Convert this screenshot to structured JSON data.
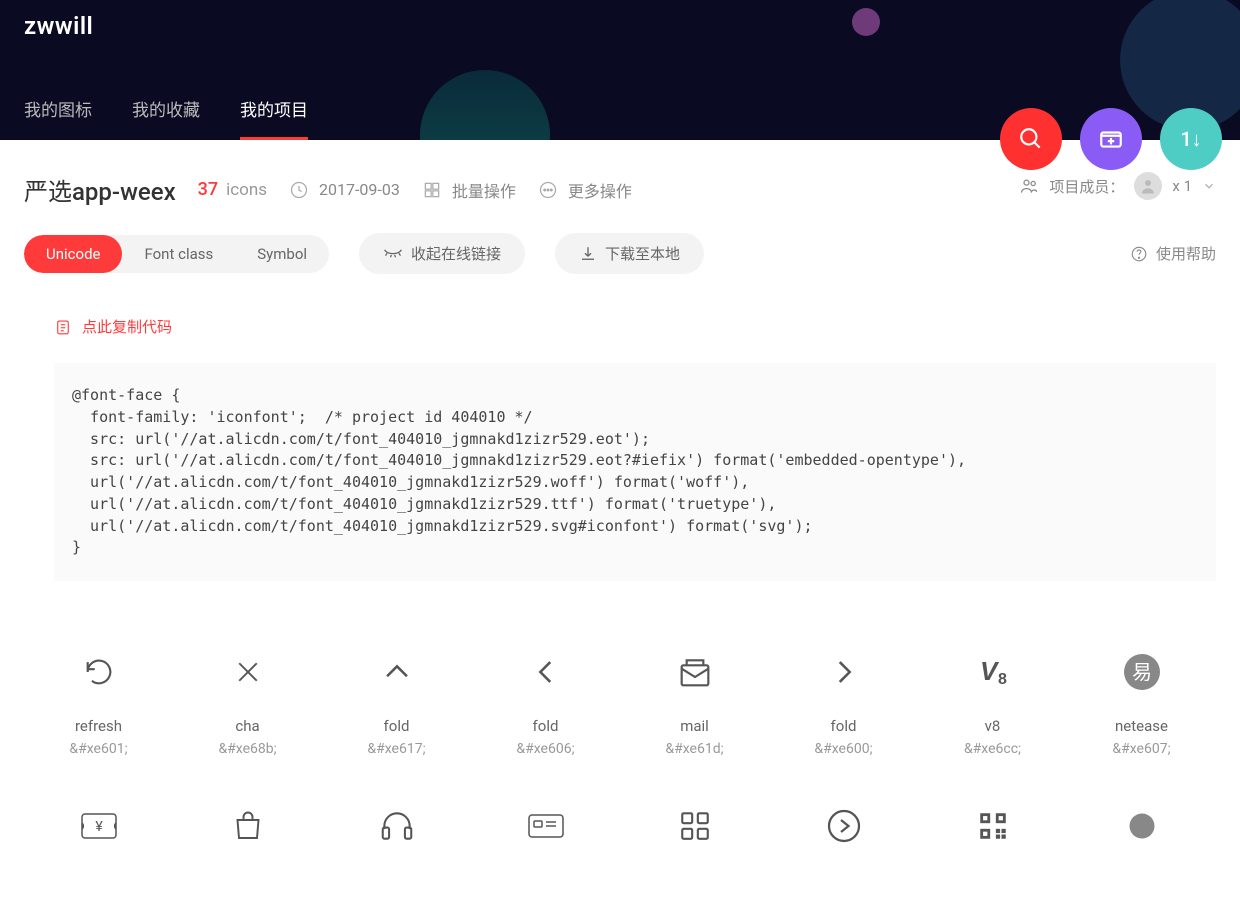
{
  "logo": "zwwill",
  "nav": {
    "tabs": [
      {
        "label": "我的图标",
        "active": false
      },
      {
        "label": "我的收藏",
        "active": false
      },
      {
        "label": "我的项目",
        "active": true
      }
    ]
  },
  "fabs": {
    "search": "search-icon",
    "add": "add-folder-icon",
    "sort": "sort-icon",
    "sort_text": "1↓"
  },
  "project": {
    "title": "严选app-weex",
    "count": "37",
    "count_label": "icons",
    "date": "2017-09-03",
    "batch": "批量操作",
    "more": "更多操作",
    "members_label": "项目成员：",
    "members_count": "x 1"
  },
  "seg": {
    "unicode": "Unicode",
    "fontclass": "Font class",
    "symbol": "Symbol"
  },
  "actions": {
    "collapse": "收起在线链接",
    "download": "下载至本地",
    "help": "使用帮助"
  },
  "code": {
    "copy_label": "点此复制代码",
    "content": "@font-face {\n  font-family: 'iconfont';  /* project id 404010 */\n  src: url('//at.alicdn.com/t/font_404010_jgmnakd1zizr529.eot');\n  src: url('//at.alicdn.com/t/font_404010_jgmnakd1zizr529.eot?#iefix') format('embedded-opentype'),\n  url('//at.alicdn.com/t/font_404010_jgmnakd1zizr529.woff') format('woff'),\n  url('//at.alicdn.com/t/font_404010_jgmnakd1zizr529.ttf') format('truetype'),\n  url('//at.alicdn.com/t/font_404010_jgmnakd1zizr529.svg#iconfont') format('svg');\n}"
  },
  "icons": [
    {
      "name": "refresh",
      "code": "&#xe601;",
      "glyph": "refresh"
    },
    {
      "name": "cha",
      "code": "&#xe68b;",
      "glyph": "cha"
    },
    {
      "name": "fold",
      "code": "&#xe617;",
      "glyph": "up"
    },
    {
      "name": "fold",
      "code": "&#xe606;",
      "glyph": "left"
    },
    {
      "name": "mail",
      "code": "&#xe61d;",
      "glyph": "mail"
    },
    {
      "name": "fold",
      "code": "&#xe600;",
      "glyph": "right"
    },
    {
      "name": "v8",
      "code": "&#xe6cc;",
      "glyph": "v8"
    },
    {
      "name": "netease",
      "code": "&#xe607;",
      "glyph": "netease"
    },
    {
      "name": "",
      "code": "",
      "glyph": "ticket"
    },
    {
      "name": "",
      "code": "",
      "glyph": "bag"
    },
    {
      "name": "",
      "code": "",
      "glyph": "headset"
    },
    {
      "name": "",
      "code": "",
      "glyph": "card"
    },
    {
      "name": "",
      "code": "",
      "glyph": "grid"
    },
    {
      "name": "",
      "code": "",
      "glyph": "next"
    },
    {
      "name": "",
      "code": "",
      "glyph": "qr"
    },
    {
      "name": "",
      "code": "",
      "glyph": "dot"
    }
  ]
}
